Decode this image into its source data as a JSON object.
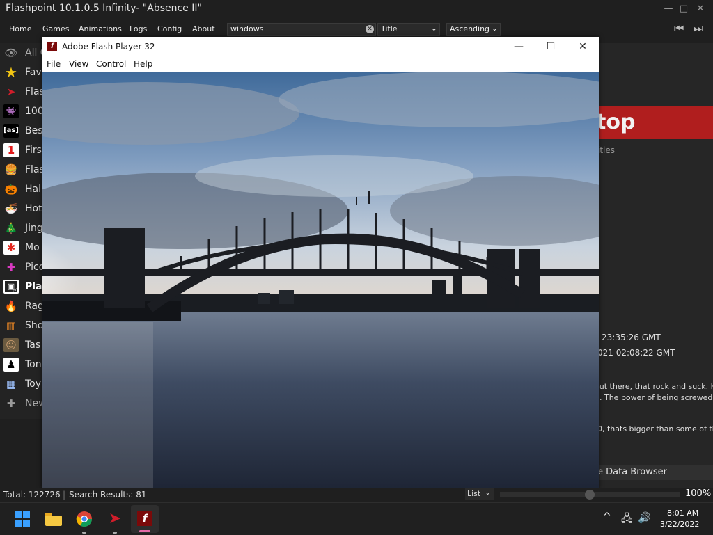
{
  "window": {
    "title": "Flashpoint 10.1.0.5 Infinity- \"Absence II\"",
    "minimize_glyph": "—",
    "maximize_glyph": "□",
    "close_glyph": "✕"
  },
  "menu": {
    "items": [
      "Home",
      "Games",
      "Animations",
      "Logs",
      "Config",
      "About"
    ]
  },
  "search": {
    "value": "windows",
    "clear_glyph": "✕"
  },
  "sort_field": {
    "value": "Title"
  },
  "sort_order": {
    "value": "Ascending"
  },
  "sidebar": {
    "items": [
      {
        "label": "All G",
        "icon": "eye-icon",
        "glyph": "👁",
        "color": "#9a9a9a"
      },
      {
        "label": "Fave",
        "icon": "star-icon",
        "glyph": "★",
        "color": "#f3c613"
      },
      {
        "label": "Flas",
        "icon": "flashpoint-logo-icon",
        "glyph": "➤",
        "color": "#d01d2a"
      },
      {
        "label": "100",
        "icon": "invader-icon",
        "glyph": "👾",
        "color": "#ffffff"
      },
      {
        "label": "Bes",
        "icon": "as-logo-icon",
        "glyph": "[as]",
        "color": "#ffffff"
      },
      {
        "label": "Firs",
        "icon": "number-one-icon",
        "glyph": "1",
        "color": "#e31c1c"
      },
      {
        "label": "Flas",
        "icon": "burger-icon",
        "glyph": "🍔",
        "color": "#e0a030"
      },
      {
        "label": "Hall",
        "icon": "pumpkin-icon",
        "glyph": "🎃",
        "color": "#ff7a1a"
      },
      {
        "label": "Hot",
        "icon": "bowl-icon",
        "glyph": "🍜",
        "color": "#ffffff"
      },
      {
        "label": "Jing",
        "icon": "tree-icon",
        "glyph": "🎄",
        "color": "#2fa33a"
      },
      {
        "label": "Mo",
        "icon": "mo-logo-icon",
        "glyph": "✱",
        "color": "#e2231a"
      },
      {
        "label": "Pico",
        "icon": "pixel-icon",
        "glyph": "✚",
        "color": "#d93ac1"
      },
      {
        "label": "Play",
        "icon": "play-logo-icon",
        "glyph": "▣",
        "color": "#ffffff"
      },
      {
        "label": "Rag",
        "icon": "fire-icon",
        "glyph": "🔥",
        "color": "#ff6a1a"
      },
      {
        "label": "Sho",
        "icon": "bars-icon",
        "glyph": "▥",
        "color": "#f08a24"
      },
      {
        "label": "Tas",
        "icon": "portrait-icon",
        "glyph": "☺",
        "color": "#c79b6e"
      },
      {
        "label": "Ton",
        "icon": "figure-icon",
        "glyph": "♟",
        "color": "#ffffff"
      },
      {
        "label": "Toy",
        "icon": "blocks-icon",
        "glyph": "▦",
        "color": "#9fc3ff"
      },
      {
        "label": "New",
        "icon": "plus-icon",
        "glyph": "✚",
        "color": "#9a9a9a"
      }
    ]
  },
  "details": {
    "banner_title": "top",
    "subtitle": "itles",
    "date1": "23:35:26 GMT",
    "date2": "021 02:08:22 GMT",
    "desc1": "out there, that rock and suck. He",
    "desc2": ". The power of being screwed!",
    "desc3": "0, thats bigger than some of the",
    "data_browser": "e Data Browser"
  },
  "flash_player": {
    "title": "Adobe Flash Player 32",
    "icon_glyph": "f",
    "menu": [
      "File",
      "View",
      "Control",
      "Help"
    ],
    "minimize_glyph": "—",
    "maximize_glyph": "☐",
    "close_glyph": "✕"
  },
  "status": {
    "total": "Total: 122726",
    "results": "Search Results: 81",
    "view_mode": "List",
    "zoom": "100%"
  },
  "taskbar": {
    "time": "8:01 AM",
    "date": "3/22/2022",
    "tray_chevron": "^"
  },
  "colors": {
    "banner": "#b01e1e",
    "flash_red": "#7a0a0a",
    "accent_pink": "#e36aa7"
  }
}
